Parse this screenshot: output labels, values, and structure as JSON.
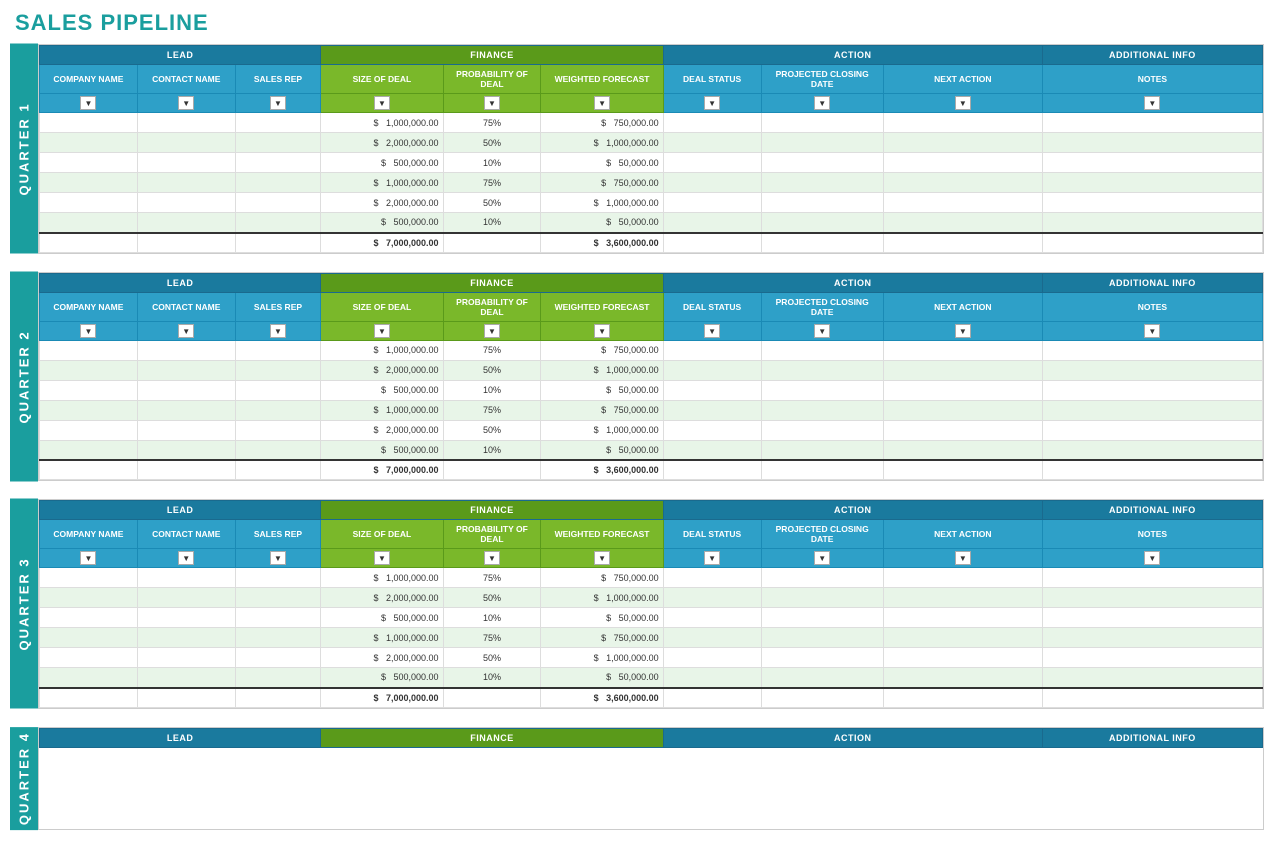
{
  "title": "SALES PIPELINE",
  "quarters": [
    {
      "label": "QUARTER 1",
      "rows": [
        {
          "company": "",
          "contact": "",
          "salesrep": "",
          "dealsize": "1,000,000.00",
          "prob": "75%",
          "weighted": "750,000.00",
          "dealstatus": "",
          "projclose": "",
          "nextaction": "",
          "notes": "",
          "alt": false
        },
        {
          "company": "",
          "contact": "",
          "salesrep": "",
          "dealsize": "2,000,000.00",
          "prob": "50%",
          "weighted": "1,000,000.00",
          "dealstatus": "",
          "projclose": "",
          "nextaction": "",
          "notes": "",
          "alt": true
        },
        {
          "company": "",
          "contact": "",
          "salesrep": "",
          "dealsize": "500,000.00",
          "prob": "10%",
          "weighted": "50,000.00",
          "dealstatus": "",
          "projclose": "",
          "nextaction": "",
          "notes": "",
          "alt": false
        },
        {
          "company": "",
          "contact": "",
          "salesrep": "",
          "dealsize": "1,000,000.00",
          "prob": "75%",
          "weighted": "750,000.00",
          "dealstatus": "",
          "projclose": "",
          "nextaction": "",
          "notes": "",
          "alt": true
        },
        {
          "company": "",
          "contact": "",
          "salesrep": "",
          "dealsize": "2,000,000.00",
          "prob": "50%",
          "weighted": "1,000,000.00",
          "dealstatus": "",
          "projclose": "",
          "nextaction": "",
          "notes": "",
          "alt": false
        },
        {
          "company": "",
          "contact": "",
          "salesrep": "",
          "dealsize": "500,000.00",
          "prob": "10%",
          "weighted": "50,000.00",
          "dealstatus": "",
          "projclose": "",
          "nextaction": "",
          "notes": "",
          "alt": true
        }
      ],
      "total_dealsize": "7,000,000.00",
      "total_weighted": "3,600,000.00"
    },
    {
      "label": "QUARTER 2",
      "rows": [
        {
          "company": "",
          "contact": "",
          "salesrep": "",
          "dealsize": "1,000,000.00",
          "prob": "75%",
          "weighted": "750,000.00",
          "dealstatus": "",
          "projclose": "",
          "nextaction": "",
          "notes": "",
          "alt": false
        },
        {
          "company": "",
          "contact": "",
          "salesrep": "",
          "dealsize": "2,000,000.00",
          "prob": "50%",
          "weighted": "1,000,000.00",
          "dealstatus": "",
          "projclose": "",
          "nextaction": "",
          "notes": "",
          "alt": true
        },
        {
          "company": "",
          "contact": "",
          "salesrep": "",
          "dealsize": "500,000.00",
          "prob": "10%",
          "weighted": "50,000.00",
          "dealstatus": "",
          "projclose": "",
          "nextaction": "",
          "notes": "",
          "alt": false
        },
        {
          "company": "",
          "contact": "",
          "salesrep": "",
          "dealsize": "1,000,000.00",
          "prob": "75%",
          "weighted": "750,000.00",
          "dealstatus": "",
          "projclose": "",
          "nextaction": "",
          "notes": "",
          "alt": true
        },
        {
          "company": "",
          "contact": "",
          "salesrep": "",
          "dealsize": "2,000,000.00",
          "prob": "50%",
          "weighted": "1,000,000.00",
          "dealstatus": "",
          "projclose": "",
          "nextaction": "",
          "notes": "",
          "alt": false
        },
        {
          "company": "",
          "contact": "",
          "salesrep": "",
          "dealsize": "500,000.00",
          "prob": "10%",
          "weighted": "50,000.00",
          "dealstatus": "",
          "projclose": "",
          "nextaction": "",
          "notes": "",
          "alt": true
        }
      ],
      "total_dealsize": "7,000,000.00",
      "total_weighted": "3,600,000.00"
    },
    {
      "label": "QUARTER 3",
      "rows": [
        {
          "company": "",
          "contact": "",
          "salesrep": "",
          "dealsize": "1,000,000.00",
          "prob": "75%",
          "weighted": "750,000.00",
          "dealstatus": "",
          "projclose": "",
          "nextaction": "",
          "notes": "",
          "alt": false
        },
        {
          "company": "",
          "contact": "",
          "salesrep": "",
          "dealsize": "2,000,000.00",
          "prob": "50%",
          "weighted": "1,000,000.00",
          "dealstatus": "",
          "projclose": "",
          "nextaction": "",
          "notes": "",
          "alt": true
        },
        {
          "company": "",
          "contact": "",
          "salesrep": "",
          "dealsize": "500,000.00",
          "prob": "10%",
          "weighted": "50,000.00",
          "dealstatus": "",
          "projclose": "",
          "nextaction": "",
          "notes": "",
          "alt": false
        },
        {
          "company": "",
          "contact": "",
          "salesrep": "",
          "dealsize": "1,000,000.00",
          "prob": "75%",
          "weighted": "750,000.00",
          "dealstatus": "",
          "projclose": "",
          "nextaction": "",
          "notes": "",
          "alt": true
        },
        {
          "company": "",
          "contact": "",
          "salesrep": "",
          "dealsize": "2,000,000.00",
          "prob": "50%",
          "weighted": "1,000,000.00",
          "dealstatus": "",
          "projclose": "",
          "nextaction": "",
          "notes": "",
          "alt": false
        },
        {
          "company": "",
          "contact": "",
          "salesrep": "",
          "dealsize": "500,000.00",
          "prob": "10%",
          "weighted": "50,000.00",
          "dealstatus": "",
          "projclose": "",
          "nextaction": "",
          "notes": "",
          "alt": true
        }
      ],
      "total_dealsize": "7,000,000.00",
      "total_weighted": "3,600,000.00"
    }
  ],
  "quarter4_label": "QUARTER 4",
  "section_labels": {
    "lead": "LEAD",
    "finance": "FINANCE",
    "action": "ACTION",
    "additional": "ADDITIONAL INFO"
  },
  "col_headers": {
    "company": "COMPANY NAME",
    "contact": "CONTACT NAME",
    "salesrep": "SALES REP",
    "dealsize": "SIZE OF DEAL",
    "prob": "PROBABILITY OF DEAL",
    "weighted": "WEIGHTED FORECAST",
    "dealstatus": "DEAL STATUS",
    "projclose": "PROJECTED CLOSING DATE",
    "nextaction": "NEXT ACTION",
    "notes": "NOTES"
  },
  "colors": {
    "teal_header": "#1a7a9e",
    "teal_col": "#2ea0c8",
    "green_header": "#5a9a1a",
    "green_col": "#7ab82a",
    "quarter_bg": "#1a9e9e",
    "title": "#1a9e9e"
  }
}
